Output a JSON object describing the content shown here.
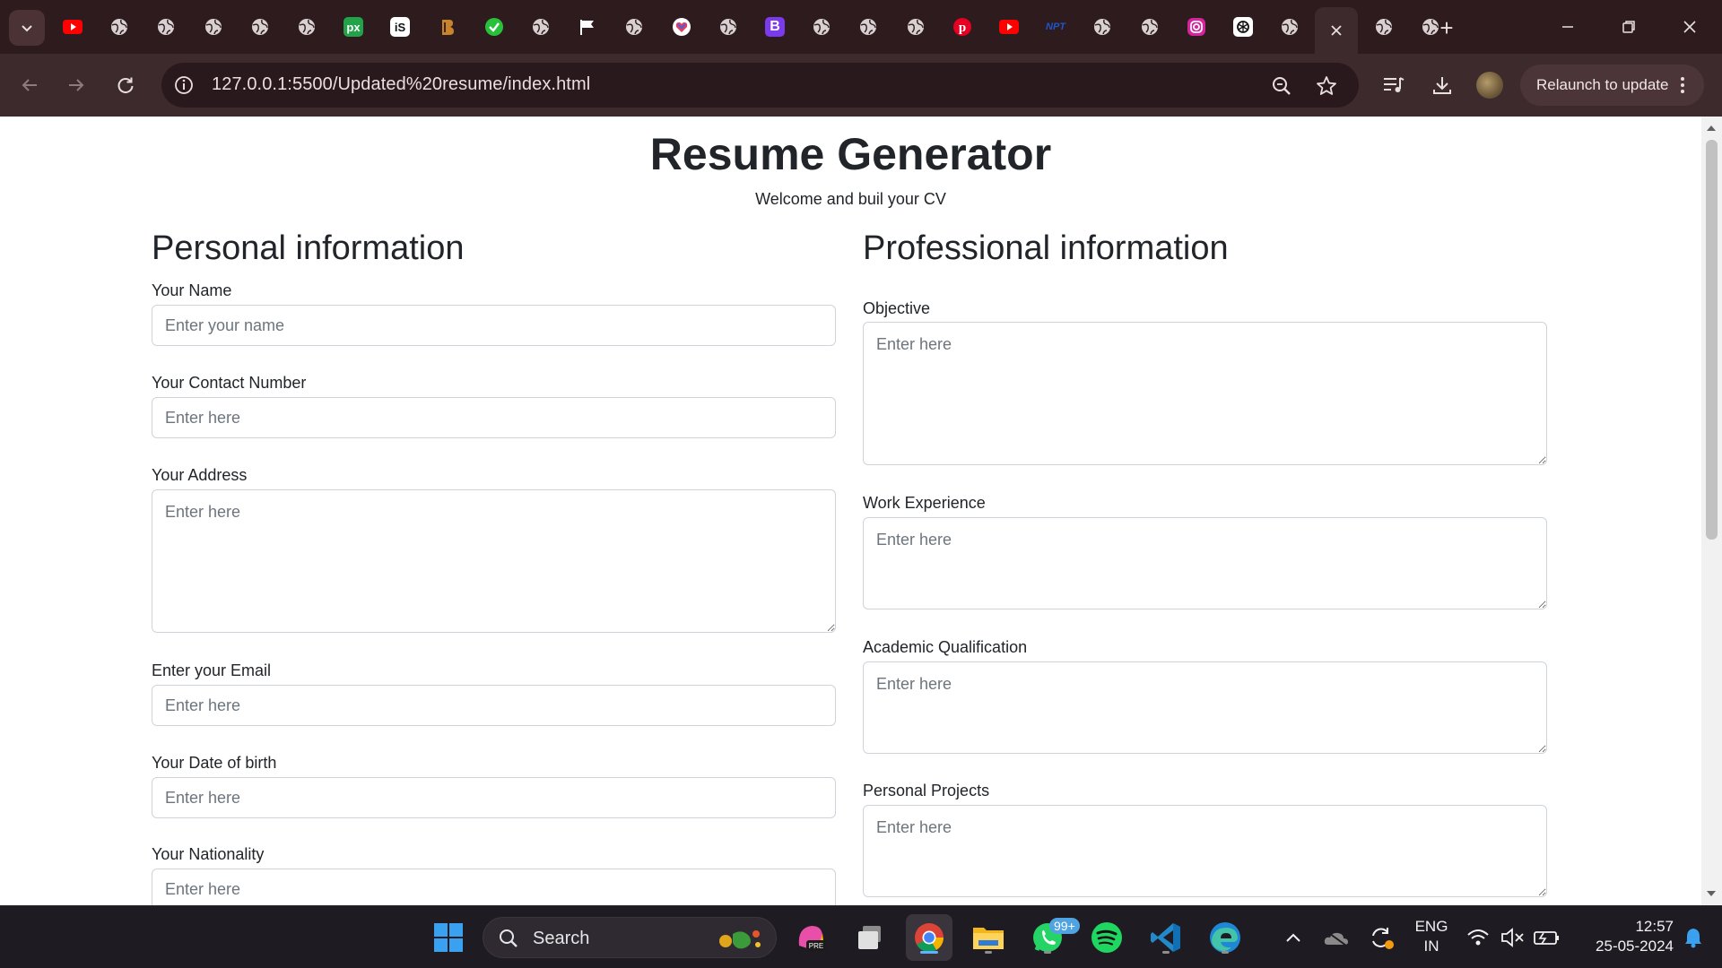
{
  "browser": {
    "url": "127.0.0.1:5500/Updated%20resume/index.html",
    "relaunch_label": "Relaunch to update",
    "tabs": [
      {
        "icon": "youtube-icon",
        "color": "#ff0000"
      },
      {
        "icon": "globe-icon"
      },
      {
        "icon": "globe-icon"
      },
      {
        "icon": "globe-icon"
      },
      {
        "icon": "globe-icon"
      },
      {
        "icon": "globe-icon"
      },
      {
        "icon": "px-icon",
        "text": "px",
        "color": "#22a34a"
      },
      {
        "icon": "is-icon",
        "text": "iS",
        "color": "#111111"
      },
      {
        "icon": "brand-b-icon",
        "color": "#7a5a2a"
      },
      {
        "icon": "check-circle-icon",
        "color": "#27c23a"
      },
      {
        "icon": "globe-icon"
      },
      {
        "icon": "flag-icon"
      },
      {
        "icon": "globe-icon"
      },
      {
        "icon": "heart-logo-icon"
      },
      {
        "icon": "globe-icon"
      },
      {
        "icon": "bootstrap-icon",
        "text": "B",
        "color": "#7c3aed"
      },
      {
        "icon": "globe-icon"
      },
      {
        "icon": "globe-icon"
      },
      {
        "icon": "globe-icon"
      },
      {
        "icon": "pinterest-icon",
        "color": "#e60023"
      },
      {
        "icon": "youtube-icon",
        "color": "#ff0000"
      },
      {
        "icon": "nptel-icon",
        "text": "NPT",
        "color": "#1e56c9"
      },
      {
        "icon": "globe-icon"
      },
      {
        "icon": "globe-icon"
      },
      {
        "icon": "instagram-icon",
        "color": "#d6249f"
      },
      {
        "icon": "chatgpt-icon"
      },
      {
        "icon": "globe-icon"
      },
      {
        "icon": "close-icon"
      },
      {
        "icon": "globe-icon"
      },
      {
        "icon": "globe-icon"
      }
    ]
  },
  "page": {
    "title": "Resume Generator",
    "subtitle": "Welcome and buil your CV",
    "personal": {
      "heading": "Personal information",
      "fields": {
        "name": {
          "label": "Your Name",
          "placeholder": "Enter your name",
          "value": ""
        },
        "contact": {
          "label": "Your Contact Number",
          "placeholder": "Enter here",
          "value": ""
        },
        "address": {
          "label": "Your Address",
          "placeholder": "Enter here",
          "value": ""
        },
        "email": {
          "label": "Enter your Email",
          "placeholder": "Enter here",
          "value": ""
        },
        "dob": {
          "label": "Your Date of birth",
          "placeholder": "Enter here",
          "value": ""
        },
        "nationality": {
          "label": "Your Nationality",
          "placeholder": "Enter here",
          "value": ""
        }
      }
    },
    "professional": {
      "heading": "Professional information",
      "fields": {
        "objective": {
          "label": "Objective",
          "placeholder": "Enter here",
          "value": ""
        },
        "experience": {
          "label": "Work Experience",
          "placeholder": "Enter here",
          "value": ""
        },
        "academic": {
          "label": "Academic Qualification",
          "placeholder": "Enter here",
          "value": ""
        },
        "projects": {
          "label": "Personal Projects",
          "placeholder": "Enter here",
          "value": ""
        }
      }
    }
  },
  "taskbar": {
    "search_label": "Search",
    "whatsapp_badge": "99+",
    "language_line1": "ENG",
    "language_line2": "IN",
    "time": "12:57",
    "date": "25-05-2024"
  }
}
